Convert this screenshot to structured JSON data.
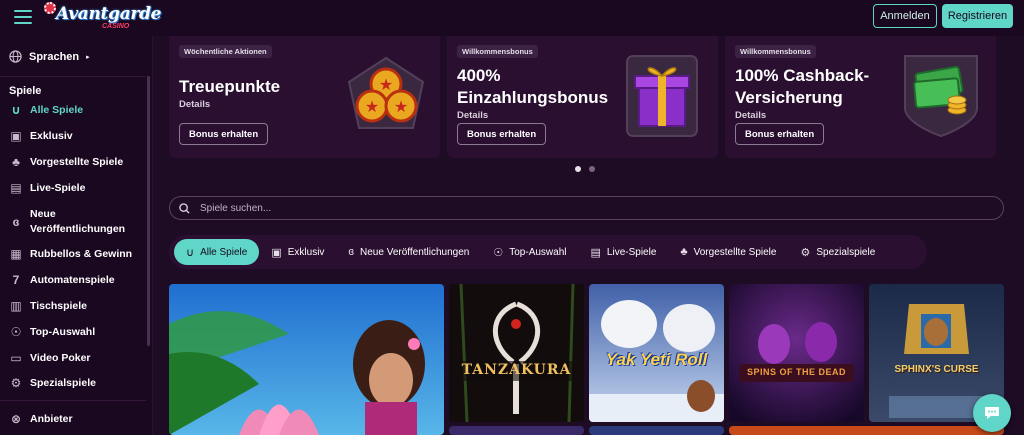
{
  "header": {
    "logo_text": "Avantgarde",
    "logo_sub": "CASINO",
    "login_label": "Anmelden",
    "register_label": "Registrieren"
  },
  "sidebar": {
    "language_label": "Sprachen",
    "section_label": "Spiele",
    "items": [
      {
        "label": "Alle Spiele",
        "icon": "horseshoe-icon",
        "active": true
      },
      {
        "label": "Exklusiv",
        "icon": "film-icon"
      },
      {
        "label": "Vorgestellte Spiele",
        "icon": "clover-icon"
      },
      {
        "label": "Live-Spiele",
        "icon": "cards-icon"
      },
      {
        "label": "Neue Veröffentlichungen",
        "icon": "cherry-icon"
      },
      {
        "label": "Rubbellos & Gewinn",
        "icon": "ticket-icon"
      },
      {
        "label": "Automatenspiele",
        "icon": "seven-icon"
      },
      {
        "label": "Tischspiele",
        "icon": "table-icon"
      },
      {
        "label": "Top-Auswahl",
        "icon": "medal-icon"
      },
      {
        "label": "Video Poker",
        "icon": "poker-icon"
      },
      {
        "label": "Spezialspiele",
        "icon": "gear-icon"
      }
    ],
    "provider_label": "Anbieter"
  },
  "promos": [
    {
      "tag": "Wöchentliche Aktionen",
      "title": "Treuepunkte",
      "details": "Details",
      "button": "Bonus erhalten",
      "art": "coins-icon"
    },
    {
      "tag": "Willkommensbonus",
      "title_line1": "400%",
      "title_line2": "Einzahlungsbonus",
      "details": "Details",
      "button": "Bonus erhalten",
      "art": "gift-icon"
    },
    {
      "tag": "Willkommensbonus",
      "title_line1": "100% Cashback-",
      "title_line2": "Versicherung",
      "details": "Details",
      "button": "Bonus erhalten",
      "art": "cash-icon"
    }
  ],
  "search": {
    "placeholder": "Spiele suchen..."
  },
  "tabs": [
    {
      "label": "Alle Spiele",
      "icon": "horseshoe-icon",
      "active": true
    },
    {
      "label": "Exklusiv",
      "icon": "film-icon"
    },
    {
      "label": "Neue Veröffentlichungen",
      "icon": "cherry-icon"
    },
    {
      "label": "Top-Auswahl",
      "icon": "medal-icon"
    },
    {
      "label": "Live-Spiele",
      "icon": "cards-icon"
    },
    {
      "label": "Vorgestellte Spiele",
      "icon": "clover-icon"
    },
    {
      "label": "Spezialspiele",
      "icon": "gear-icon"
    }
  ],
  "games": [
    {
      "title": "",
      "art": "lotus-woman"
    },
    {
      "title": "TANZAKURA",
      "art": "crane"
    },
    {
      "title": "Yak Yeti Roll",
      "art": "yeti"
    },
    {
      "title": "SPINS OF THE DEAD",
      "art": "dead"
    },
    {
      "title": "SPHINX'S CURSE",
      "art": "sphinx"
    }
  ],
  "colors": {
    "accent": "#5fd6c8",
    "background": "#1e0b24",
    "panel": "#2a0f30"
  }
}
